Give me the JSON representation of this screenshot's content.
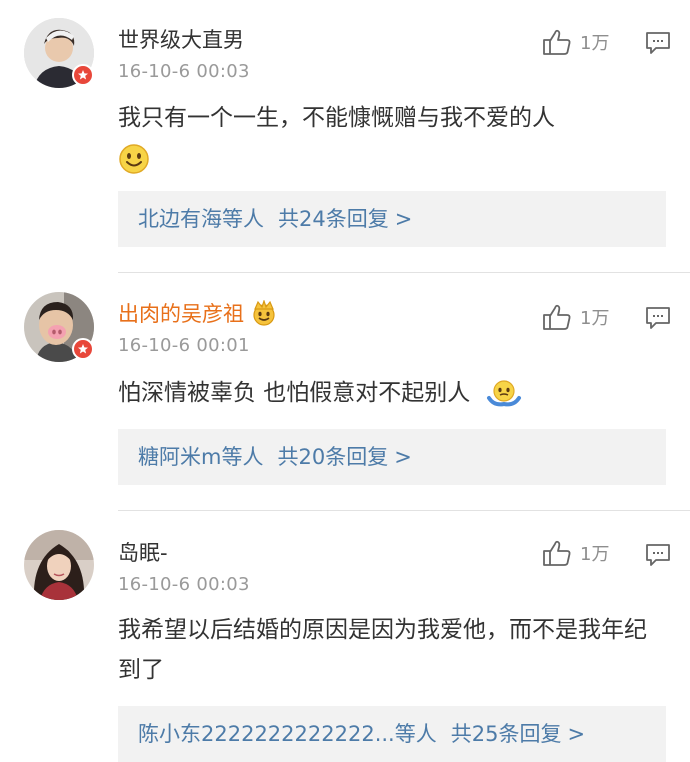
{
  "comments": [
    {
      "username": "世界级大直男",
      "timestamp": "16-10-6 00:03",
      "likes": "1万",
      "text": "我只有一个一生，不能慷慨赠与我不爱的人",
      "emoji": "smiley-face-icon",
      "replies": {
        "who": "北边有海等人",
        "total": "共24条回复",
        "arrow": ">"
      }
    },
    {
      "username": "出肉的吴彦祖",
      "timestamp": "16-10-6 00:01",
      "likes": "1万",
      "text": "怕深情被辜负 也怕假意对不起别人",
      "emoji": "shrug-face-icon",
      "replies": {
        "who": "糖阿米m等人",
        "total": "共20条回复",
        "arrow": ">"
      }
    },
    {
      "username": "岛眠-",
      "timestamp": "16-10-6 00:03",
      "likes": "1万",
      "text": "我希望以后结婚的原因是因为我爱他，而不是我年纪到了",
      "replies": {
        "who": "陈小东2222222222222...等人",
        "total": "共25条回复",
        "arrow": ">"
      }
    }
  ],
  "colors": {
    "link": "#4d7ba8",
    "gold_name": "#e8701a",
    "badge": "#e8473a",
    "reply_bg": "#f2f2f2"
  }
}
